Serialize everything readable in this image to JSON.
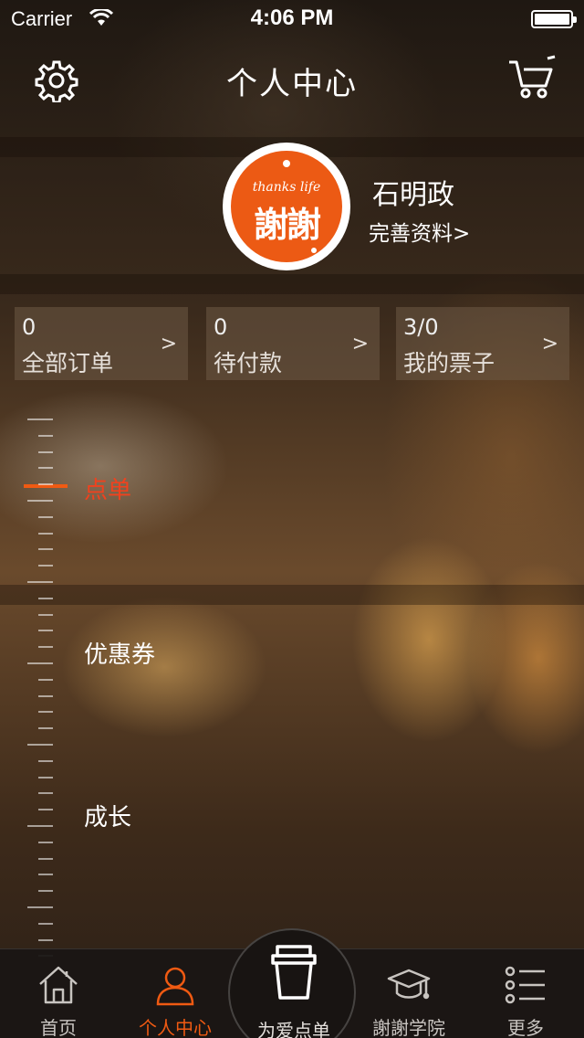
{
  "status_bar": {
    "carrier": "Carrier",
    "time": "4:06 PM"
  },
  "nav": {
    "title": "个人中心",
    "left_icon": "gear-icon",
    "right_icon": "cart-icon"
  },
  "profile": {
    "avatar_tagline": "thanks life",
    "avatar_logo": "謝謝",
    "username": "石明政",
    "complete_profile_link": "完善资料>"
  },
  "stats": [
    {
      "count": "0",
      "label": "全部订单",
      "arrow": ">"
    },
    {
      "count": "0",
      "label": "待付款",
      "arrow": ">"
    },
    {
      "count": "3/0",
      "label": "我的票子",
      "arrow": ">"
    }
  ],
  "side_menu": [
    {
      "label": "点单",
      "active": true
    },
    {
      "label": "优惠券",
      "active": false
    },
    {
      "label": "成长",
      "active": false
    }
  ],
  "tabbar": [
    {
      "label": "首页",
      "icon": "home-icon",
      "active": false
    },
    {
      "label": "个人中心",
      "icon": "person-icon",
      "active": true
    },
    {
      "label": "为爱点单",
      "icon": "coffee-cup-icon",
      "active": false
    },
    {
      "label": "謝謝学院",
      "icon": "graduation-cap-icon",
      "active": false
    },
    {
      "label": "更多",
      "icon": "list-icon",
      "active": false
    }
  ],
  "colors": {
    "accent": "#f05a12",
    "active_menu": "#f0421e",
    "logo_orange": "#ec5a14"
  }
}
